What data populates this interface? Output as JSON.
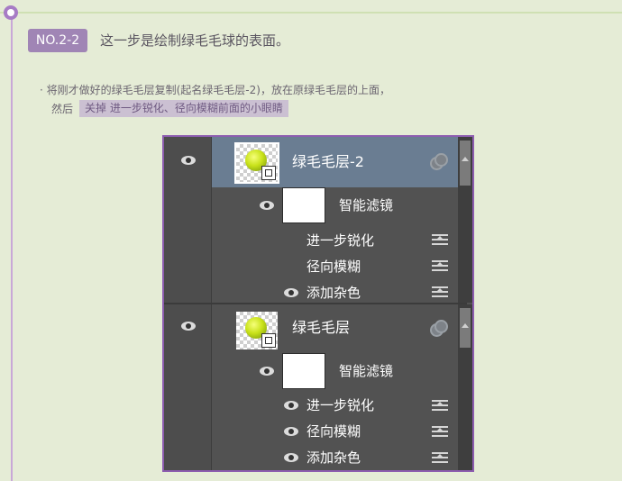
{
  "step": {
    "badge": "NO.2-2",
    "title": "这一步是绘制绿毛毛球的表面。"
  },
  "notes": {
    "line1": "· 将刚才做好的绿毛毛层复制(起名绿毛毛层-2)，放在原绿毛毛层的上面，",
    "line2_prefix": "然后",
    "highlight": "关掉 进一步锐化、径向模糊前面的小眼睛"
  },
  "layers_panel": {
    "layers": [
      {
        "name": "绿毛毛层-2",
        "selected": true,
        "smart_filters_label": "智能滤镜",
        "filters": [
          {
            "name": "进一步锐化",
            "visible": false
          },
          {
            "name": "径向模糊",
            "visible": false
          },
          {
            "name": "添加杂色",
            "visible": true
          }
        ]
      },
      {
        "name": "绿毛毛层",
        "selected": false,
        "smart_filters_label": "智能滤镜",
        "filters": [
          {
            "name": "进一步锐化",
            "visible": true
          },
          {
            "name": "径向模糊",
            "visible": true
          },
          {
            "name": "添加杂色",
            "visible": true
          }
        ]
      }
    ]
  },
  "colors": {
    "accent_purple": "#a085b5",
    "panel_border": "#8d5db0",
    "selected_layer": "#6a7d92"
  }
}
